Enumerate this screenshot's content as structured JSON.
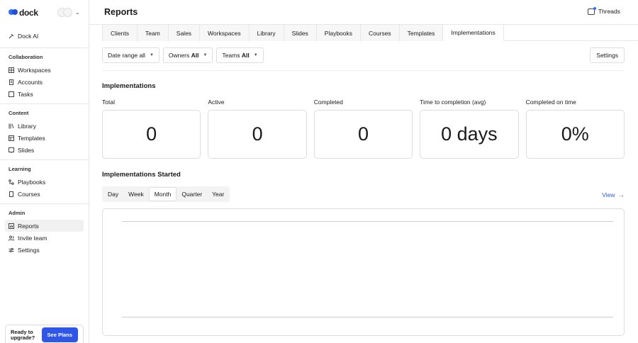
{
  "brand": {
    "name": "dock"
  },
  "sidebar": {
    "top_item": {
      "label": "Dock AI",
      "icon": "sparkle-icon"
    },
    "sections": [
      {
        "title": "Collaboration",
        "items": [
          {
            "label": "Workspaces",
            "icon": "grid-icon"
          },
          {
            "label": "Accounts",
            "icon": "building-icon"
          },
          {
            "label": "Tasks",
            "icon": "checkbox-icon"
          }
        ]
      },
      {
        "title": "Content",
        "items": [
          {
            "label": "Library",
            "icon": "library-icon"
          },
          {
            "label": "Templates",
            "icon": "template-icon"
          },
          {
            "label": "Slides",
            "icon": "slides-icon"
          }
        ]
      },
      {
        "title": "Learning",
        "items": [
          {
            "label": "Playbooks",
            "icon": "playbook-icon"
          },
          {
            "label": "Courses",
            "icon": "book-icon"
          }
        ]
      },
      {
        "title": "Admin",
        "items": [
          {
            "label": "Reports",
            "icon": "chart-icon",
            "active": true
          },
          {
            "label": "Invite team",
            "icon": "users-icon"
          },
          {
            "label": "Settings",
            "icon": "sliders-icon"
          }
        ]
      }
    ],
    "upgrade": {
      "text": "Ready to upgrade?",
      "button": "See Plans"
    }
  },
  "header": {
    "title": "Reports",
    "threads": "Threads"
  },
  "tabs": [
    "Clients",
    "Team",
    "Sales",
    "Workspaces",
    "Library",
    "Slides",
    "Playbooks",
    "Courses",
    "Templates",
    "Implementations"
  ],
  "active_tab": "Implementations",
  "filters": {
    "date_range": {
      "label": "Date range",
      "value": "all"
    },
    "owners": {
      "label": "Owners",
      "value": "All"
    },
    "teams": {
      "label": "Teams",
      "value": "All"
    },
    "settings": "Settings"
  },
  "implementations": {
    "title": "Implementations",
    "metrics": [
      {
        "label": "Total",
        "value": "0"
      },
      {
        "label": "Active",
        "value": "0"
      },
      {
        "label": "Completed",
        "value": "0"
      },
      {
        "label": "Time to completion (avg)",
        "value": "0 days"
      },
      {
        "label": "Completed on time",
        "value": "0%"
      }
    ]
  },
  "started": {
    "title": "Implementations Started",
    "ranges": [
      "Day",
      "Week",
      "Month",
      "Quarter",
      "Year"
    ],
    "active_range": "Month",
    "view_link": "View"
  }
}
